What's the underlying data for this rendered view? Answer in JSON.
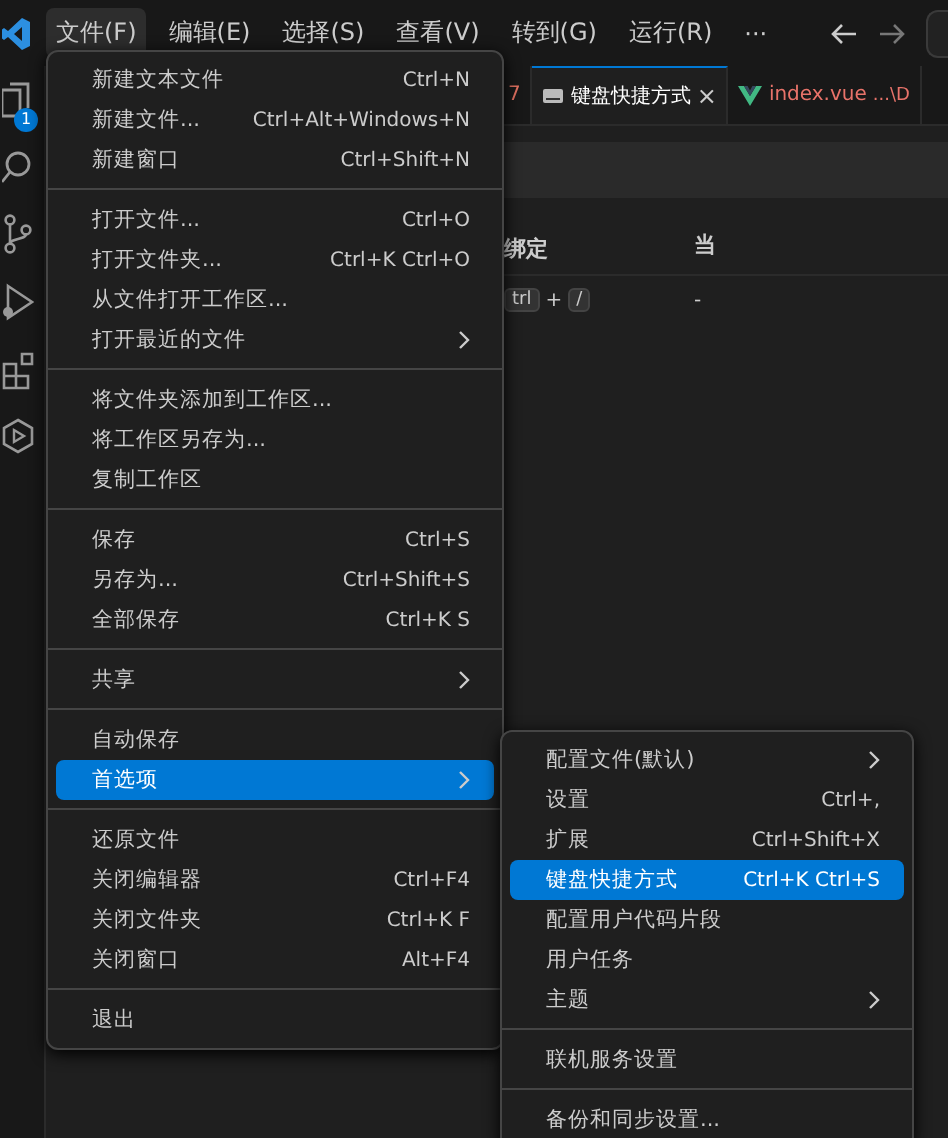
{
  "menubar": [
    {
      "label": "文件(F)",
      "selected": true
    },
    {
      "label": "编辑(E)",
      "selected": false
    },
    {
      "label": "选择(S)",
      "selected": false
    },
    {
      "label": "查看(V)",
      "selected": false
    },
    {
      "label": "转到(G)",
      "selected": false
    },
    {
      "label": "运行(R)",
      "selected": false
    },
    {
      "label": "···",
      "selected": false
    }
  ],
  "activity_bar": {
    "badge": "1"
  },
  "tabs": [
    {
      "label": "7",
      "kind": "partial",
      "selected": false
    },
    {
      "label": "键盘快捷方式",
      "kind": "keyboard",
      "selected": true,
      "close": "×"
    },
    {
      "label": "index.vue",
      "detail": "...\\D",
      "kind": "vue",
      "selected": false
    }
  ],
  "table": {
    "columns": [
      "绑定",
      "当"
    ],
    "rows": [
      {
        "keys": [
          "trl",
          "/"
        ],
        "joiner": "+",
        "when": "-"
      }
    ]
  },
  "file_menu": [
    {
      "kind": "item",
      "label": "新建文本文件",
      "shortcut": "Ctrl+N",
      "submenu": false,
      "selected": false
    },
    {
      "kind": "item",
      "label": "新建文件...",
      "shortcut": "Ctrl+Alt+Windows+N",
      "submenu": false,
      "selected": false
    },
    {
      "kind": "item",
      "label": "新建窗口",
      "shortcut": "Ctrl+Shift+N",
      "submenu": false,
      "selected": false
    },
    {
      "kind": "separator"
    },
    {
      "kind": "item",
      "label": "打开文件...",
      "shortcut": "Ctrl+O",
      "submenu": false,
      "selected": false
    },
    {
      "kind": "item",
      "label": "打开文件夹...",
      "shortcut": "Ctrl+K Ctrl+O",
      "submenu": false,
      "selected": false
    },
    {
      "kind": "item",
      "label": "从文件打开工作区...",
      "submenu": false,
      "selected": false
    },
    {
      "kind": "item",
      "label": "打开最近的文件",
      "submenu": true,
      "selected": false
    },
    {
      "kind": "separator"
    },
    {
      "kind": "item",
      "label": "将文件夹添加到工作区...",
      "submenu": false,
      "selected": false
    },
    {
      "kind": "item",
      "label": "将工作区另存为...",
      "submenu": false,
      "selected": false
    },
    {
      "kind": "item",
      "label": "复制工作区",
      "submenu": false,
      "selected": false
    },
    {
      "kind": "separator"
    },
    {
      "kind": "item",
      "label": "保存",
      "shortcut": "Ctrl+S",
      "submenu": false,
      "selected": false
    },
    {
      "kind": "item",
      "label": "另存为...",
      "shortcut": "Ctrl+Shift+S",
      "submenu": false,
      "selected": false
    },
    {
      "kind": "item",
      "label": "全部保存",
      "shortcut": "Ctrl+K S",
      "submenu": false,
      "selected": false
    },
    {
      "kind": "separator"
    },
    {
      "kind": "item",
      "label": "共享",
      "submenu": true,
      "selected": false
    },
    {
      "kind": "separator"
    },
    {
      "kind": "item",
      "label": "自动保存",
      "submenu": false,
      "selected": false
    },
    {
      "kind": "item",
      "label": "首选项",
      "submenu": true,
      "selected": true
    },
    {
      "kind": "separator"
    },
    {
      "kind": "item",
      "label": "还原文件",
      "submenu": false,
      "selected": false
    },
    {
      "kind": "item",
      "label": "关闭编辑器",
      "shortcut": "Ctrl+F4",
      "submenu": false,
      "selected": false
    },
    {
      "kind": "item",
      "label": "关闭文件夹",
      "shortcut": "Ctrl+K F",
      "submenu": false,
      "selected": false
    },
    {
      "kind": "item",
      "label": "关闭窗口",
      "shortcut": "Alt+F4",
      "submenu": false,
      "selected": false
    },
    {
      "kind": "separator"
    },
    {
      "kind": "item",
      "label": "退出",
      "submenu": false,
      "selected": false
    }
  ],
  "preferences_menu": [
    {
      "kind": "item",
      "label": "配置文件(默认)",
      "submenu": true,
      "selected": false
    },
    {
      "kind": "item",
      "label": "设置",
      "shortcut": "Ctrl+,",
      "submenu": false,
      "selected": false
    },
    {
      "kind": "item",
      "label": "扩展",
      "shortcut": "Ctrl+Shift+X",
      "submenu": false,
      "selected": false
    },
    {
      "kind": "item",
      "label": "键盘快捷方式",
      "shortcut": "Ctrl+K Ctrl+S",
      "submenu": false,
      "selected": true
    },
    {
      "kind": "item",
      "label": "配置用户代码片段",
      "submenu": false,
      "selected": false
    },
    {
      "kind": "item",
      "label": "用户任务",
      "submenu": false,
      "selected": false
    },
    {
      "kind": "item",
      "label": "主题",
      "submenu": true,
      "selected": false
    },
    {
      "kind": "separator"
    },
    {
      "kind": "item",
      "label": "联机服务设置",
      "submenu": false,
      "selected": false
    },
    {
      "kind": "separator"
    },
    {
      "kind": "item",
      "label": "备份和同步设置...",
      "submenu": false,
      "selected": false
    }
  ]
}
